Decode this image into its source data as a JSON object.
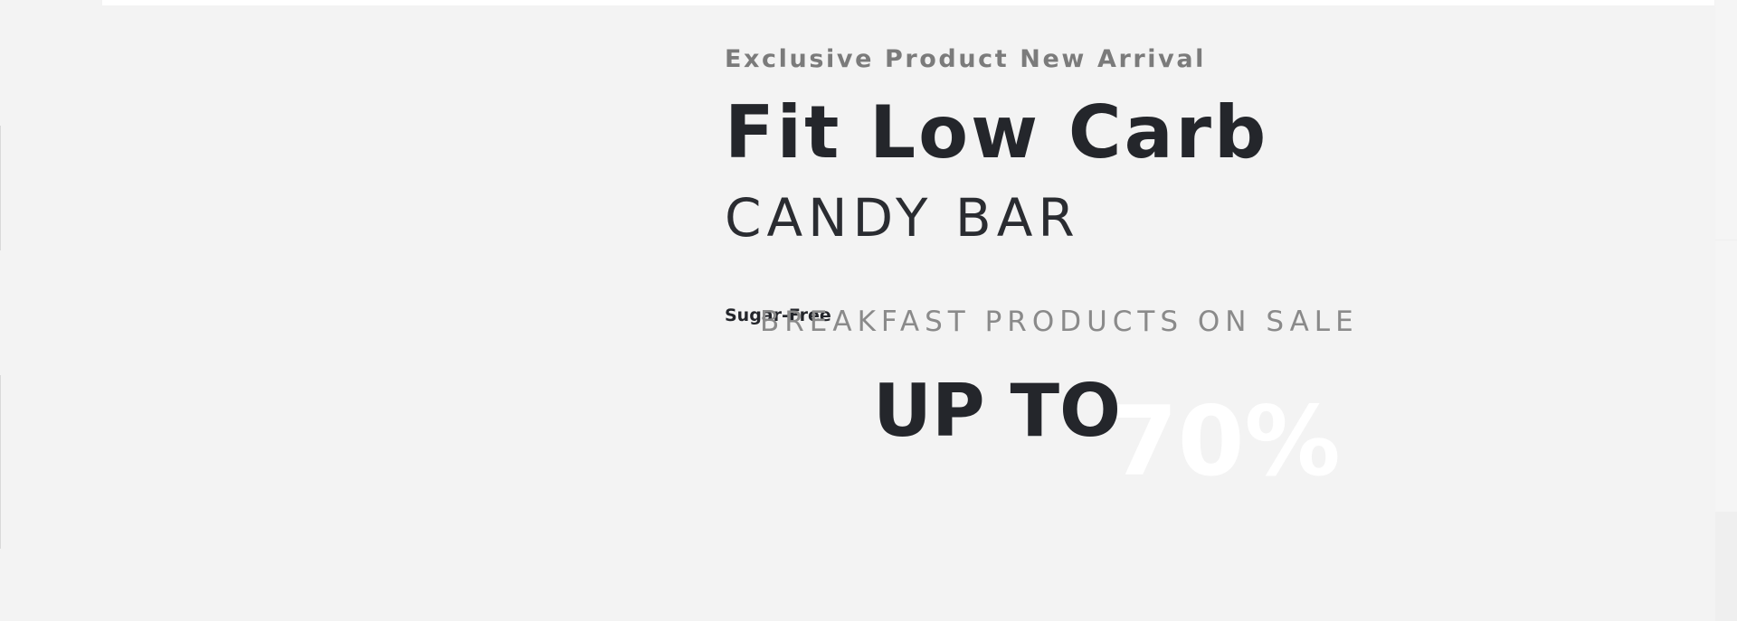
{
  "hero": {
    "slide_one": {
      "eyebrow": "Exclusive Product New Arrival",
      "title": "Fit Low Carb",
      "subtitle": "CANDY BAR",
      "tagline": "Sugar-Free"
    },
    "slide_two": {
      "eyebrow": "BREAKFAST PRODUCTS ON SALE",
      "headline": "UP TO",
      "highlight": "70%"
    }
  },
  "colors": {
    "background": "#f3f3f3",
    "heading": "#24262b",
    "muted": "#7b7b7b",
    "highlight": "#ffffff"
  }
}
